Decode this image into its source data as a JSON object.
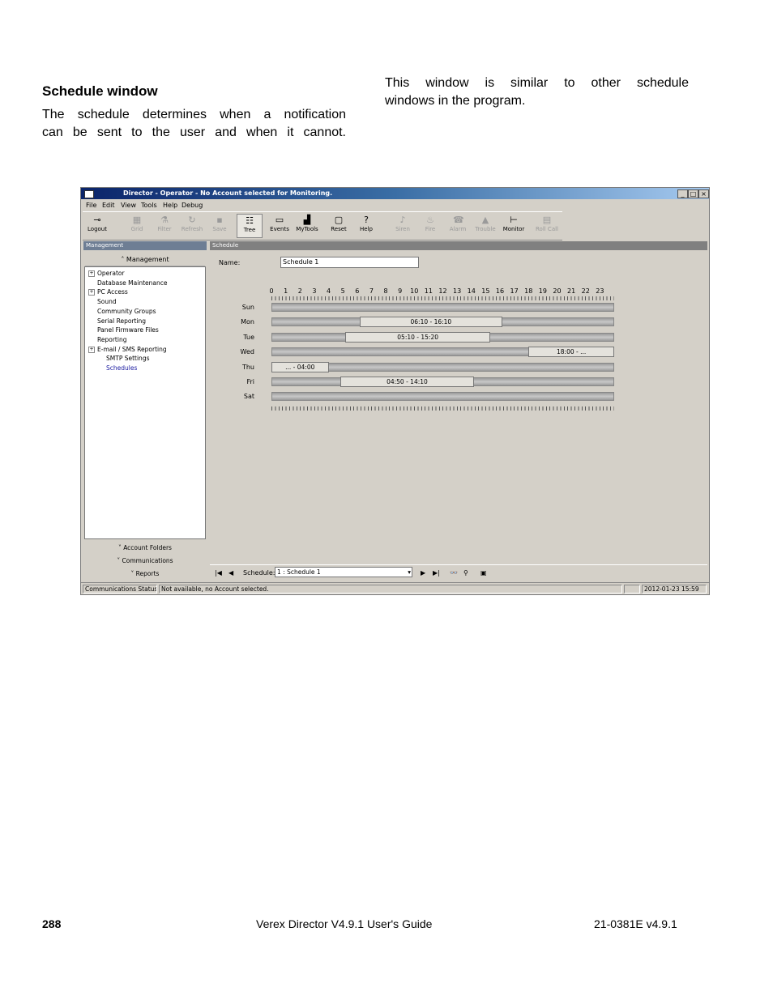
{
  "doc": {
    "heading": "Schedule window",
    "para_left": [
      "The schedule determines when a notification",
      "can be sent to the user and when it cannot."
    ],
    "para_right": [
      "This window is similar to other schedule",
      "windows in the program."
    ],
    "footer": {
      "page": "288",
      "title": "Verex Director V4.9.1 User's Guide",
      "code": "21-0381E v4.9.1"
    }
  },
  "app": {
    "title": "Director - Operator - No Account selected for Monitoring.",
    "window_buttons": [
      "_",
      "□",
      "×"
    ],
    "menu": [
      "File",
      "Edit",
      "View",
      "Tools",
      "Help",
      "Debug"
    ],
    "toolbar": [
      {
        "label": "Logout",
        "icon": "key-icon",
        "enabled": true
      },
      {
        "label": "Grid",
        "icon": "grid-icon",
        "enabled": false
      },
      {
        "label": "Filter",
        "icon": "filter-icon",
        "enabled": false
      },
      {
        "label": "Refresh",
        "icon": "refresh-icon",
        "enabled": false
      },
      {
        "label": "Save",
        "icon": "save-icon",
        "enabled": false
      },
      {
        "label": "Tree",
        "icon": "tree-icon",
        "enabled": true,
        "selected": true
      },
      {
        "label": "Events",
        "icon": "events-icon",
        "enabled": true
      },
      {
        "label": "MyTools",
        "icon": "tools-icon",
        "enabled": true
      },
      {
        "label": "Reset",
        "icon": "reset-icon",
        "enabled": true
      },
      {
        "label": "Help",
        "icon": "help-icon",
        "enabled": true
      },
      {
        "label": "Siren",
        "icon": "siren-icon",
        "enabled": false
      },
      {
        "label": "Fire",
        "icon": "fire-icon",
        "enabled": false
      },
      {
        "label": "Alarm",
        "icon": "alarm-icon",
        "enabled": false
      },
      {
        "label": "Trouble",
        "icon": "trouble-icon",
        "enabled": false
      },
      {
        "label": "Monitor",
        "icon": "monitor-icon",
        "enabled": true
      },
      {
        "label": "Roll Call",
        "icon": "rollcall-icon",
        "enabled": false
      }
    ],
    "left_panel": {
      "header": "Management",
      "section_button": "Management",
      "tree": [
        {
          "label": "Operator",
          "expandable": true
        },
        {
          "label": "Database Maintenance",
          "expandable": false
        },
        {
          "label": "PC Access",
          "expandable": true
        },
        {
          "label": "Sound",
          "expandable": false
        },
        {
          "label": "Community Groups",
          "expandable": false
        },
        {
          "label": "Serial Reporting",
          "expandable": false
        },
        {
          "label": "Panel Firmware Files",
          "expandable": false
        },
        {
          "label": "Reporting",
          "expandable": false
        },
        {
          "label": "E-mail / SMS Reporting",
          "expandable": true
        },
        {
          "label": "SMTP Settings",
          "expandable": false,
          "child": true
        },
        {
          "label": "Schedules",
          "expandable": false,
          "child": true,
          "selected": true
        }
      ],
      "nav_sections": [
        "Account Folders",
        "Communications",
        "Reports"
      ]
    },
    "schedule": {
      "header": "Schedule",
      "name_label": "Name:",
      "name_value": "Schedule 1",
      "hours": [
        "0",
        "1",
        "2",
        "3",
        "4",
        "5",
        "6",
        "7",
        "8",
        "9",
        "10",
        "11",
        "12",
        "13",
        "14",
        "15",
        "16",
        "17",
        "18",
        "19",
        "20",
        "21",
        "22",
        "23"
      ],
      "days": [
        {
          "day": "Sun",
          "segments": []
        },
        {
          "day": "Mon",
          "segments": [
            {
              "start": 6.17,
              "end": 16.17,
              "label": "06:10 - 16:10"
            }
          ]
        },
        {
          "day": "Tue",
          "segments": [
            {
              "start": 5.17,
              "end": 15.33,
              "label": "05:10 - 15:20"
            }
          ]
        },
        {
          "day": "Wed",
          "segments": [
            {
              "start": 18.0,
              "end": 24.0,
              "label": "18:00 - ..."
            }
          ]
        },
        {
          "day": "Thu",
          "segments": [
            {
              "start": 0.0,
              "end": 4.0,
              "label": "... - 04:00"
            }
          ]
        },
        {
          "day": "Fri",
          "segments": [
            {
              "start": 4.83,
              "end": 14.17,
              "label": "04:50 - 14:10"
            }
          ]
        },
        {
          "day": "Sat",
          "segments": []
        }
      ],
      "nav_label": "Schedule:",
      "nav_value": "1 : Schedule 1"
    },
    "status": {
      "label": "Communications Status:",
      "value": "Not available, no Account selected.",
      "datetime": "2012-01-23 15:59"
    }
  }
}
